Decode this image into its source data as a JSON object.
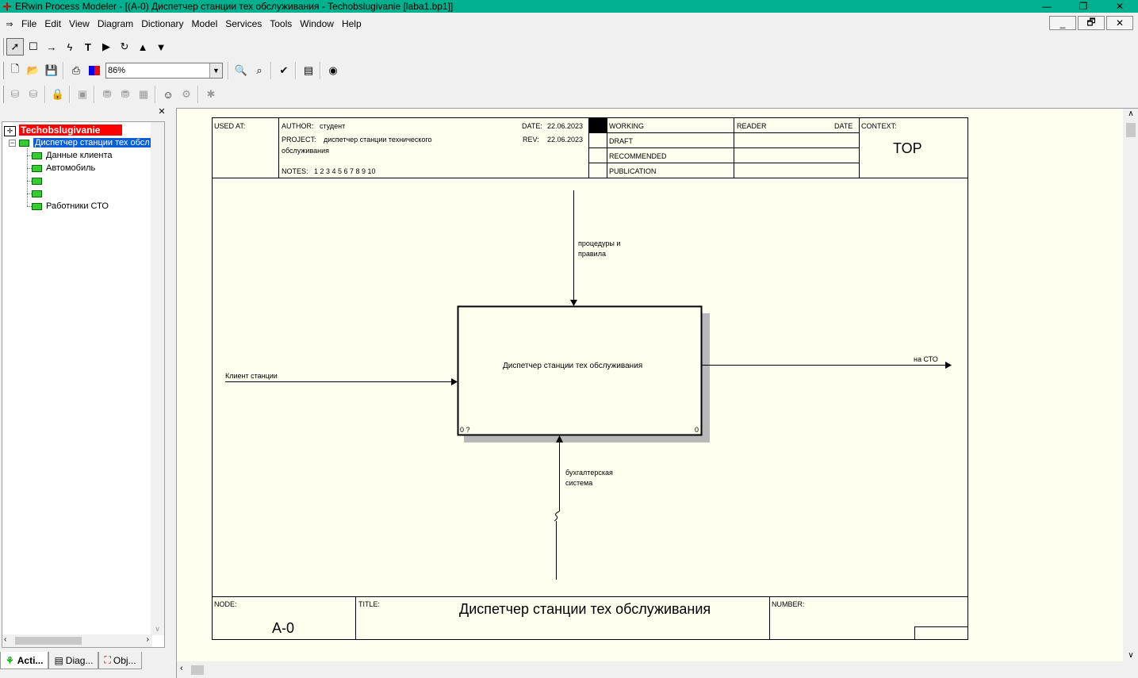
{
  "window": {
    "title": "ERwin Process Modeler - [(A-0) Диспетчер станции тех обслуживания - Techobslugivanie  [laba1.bp1]]",
    "minimize": "—",
    "maximize": "❐",
    "close": "✕"
  },
  "menu": {
    "items": [
      "File",
      "Edit",
      "View",
      "Diagram",
      "Dictionary",
      "Model",
      "Services",
      "Tools",
      "Window",
      "Help"
    ],
    "mdi_min": "_",
    "mdi_restore": "🗗",
    "mdi_close": "✕"
  },
  "toolbar": {
    "zoom_value": "86%"
  },
  "tree": {
    "root": "Techobslugivanie",
    "selected": "Диспетчер станции тех обсл",
    "children": [
      "Данные клиента",
      "Автомобиль",
      "",
      "",
      "Работники СТО"
    ]
  },
  "tabs": {
    "activities": "Acti...",
    "diagrams": "Diag...",
    "objects": "Obj..."
  },
  "frame": {
    "used_at_label": "USED AT:",
    "author_label": "AUTHOR:",
    "author_value": "студент",
    "date_label": "DATE:",
    "date_value": "22.06.2023",
    "project_label": "PROJECT:",
    "project_value_line1": "диспетчер станции технического",
    "project_value_line2": "обслуживания",
    "rev_label": "REV:",
    "rev_value": "22.06.2023",
    "notes_label": "NOTES:",
    "notes_value": "1  2  3  4  5  6  7  8  9  10",
    "status": [
      "WORKING",
      "DRAFT",
      "RECOMMENDED",
      "PUBLICATION"
    ],
    "reader_label": "READER",
    "reader_date_label": "DATE",
    "context_label": "CONTEXT:",
    "context_value": "TOP",
    "node_label": "NODE:",
    "node_value": "A-0",
    "title_label": "TITLE:",
    "title_value": "Диспетчер станции тех обслуживания",
    "number_label": "NUMBER:"
  },
  "diagram": {
    "activity_name": "Диспетчер станции тех обслуживания",
    "activity_cost": "0 ?",
    "activity_number": "0",
    "control_label_line1": "процедуры и",
    "control_label_line2": "правила",
    "input_label": "Клиент станции",
    "output_label": "на СТО",
    "mechanism_label_line1": "бухгалтерская",
    "mechanism_label_line2": "система"
  }
}
